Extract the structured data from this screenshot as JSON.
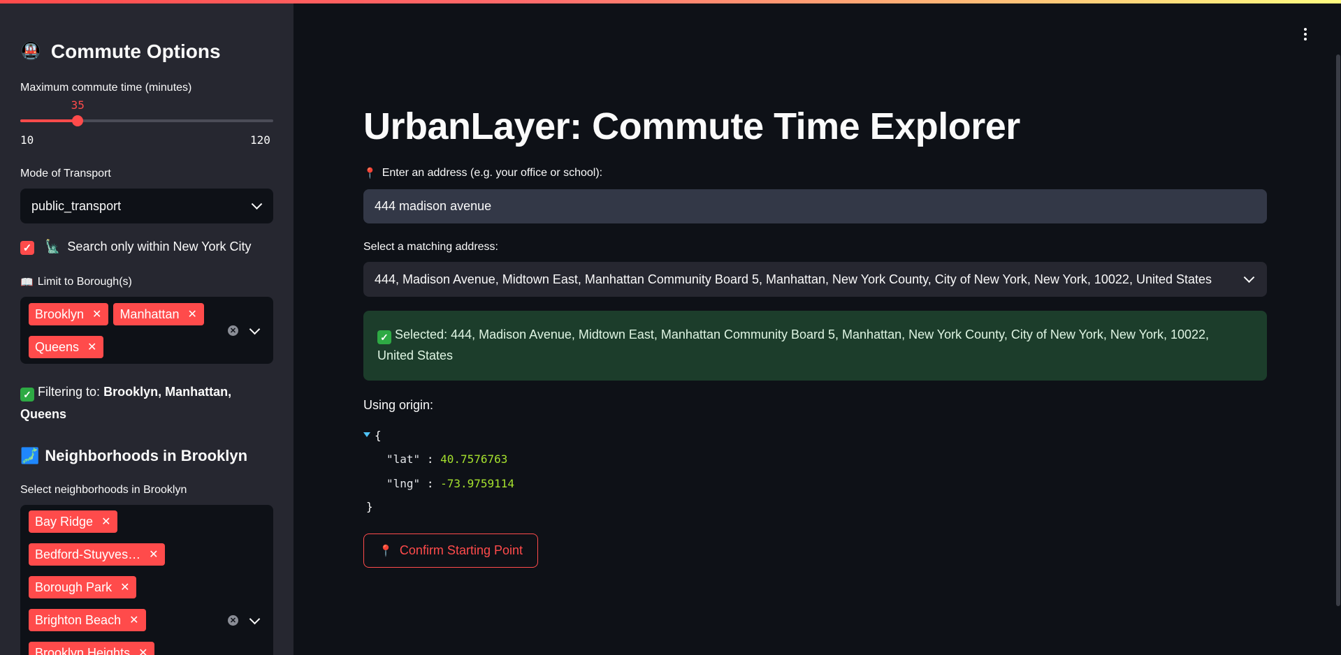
{
  "sidebar": {
    "title": "Commute Options",
    "title_icon": "🚇",
    "slider": {
      "label": "Maximum commute time (minutes)",
      "value": 35,
      "value_text": "35",
      "min": 10,
      "max": 120,
      "min_text": "10",
      "max_text": "120"
    },
    "transport": {
      "label": "Mode of Transport",
      "selected": "public_transport"
    },
    "nyc_checkbox": {
      "checked": true,
      "icon": "🗽",
      "label": "Search only within New York City"
    },
    "borough": {
      "icon": "📖",
      "label": "Limit to Borough(s)",
      "tags": [
        "Brooklyn",
        "Manhattan",
        "Queens"
      ]
    },
    "filter_info": {
      "prefix": "Filtering to:",
      "value": "Brooklyn, Manhattan,",
      "value2": "Queens"
    },
    "neighborhoods_header": {
      "icon": "🗾",
      "title": "Neighborhoods in Brooklyn"
    },
    "neighborhoods": {
      "label": "Select neighborhoods in Brooklyn",
      "tags": [
        "Bay Ridge",
        "Bedford-Stuyves…",
        "Borough Park",
        "Brighton Beach",
        "Brooklyn Heights"
      ]
    }
  },
  "main": {
    "title": "UrbanLayer: Commute Time Explorer",
    "address": {
      "icon": "📍",
      "label": "Enter an address (e.g. your office or school):",
      "value": "444 madison avenue"
    },
    "match": {
      "label": "Select a matching address:",
      "selected": "444, Madison Avenue, Midtown East, Manhattan Community Board 5, Manhattan, New York County, City of New York, New York, 10022, United States"
    },
    "success": {
      "text": "Selected: 444, Madison Avenue, Midtown East, Manhattan Community Board 5, Manhattan, New York County, City of New York, New York, 10022,",
      "text2": "United States"
    },
    "origin_label": "Using origin:",
    "origin": {
      "lat_key": "\"lat\"",
      "lat": "40.7576763",
      "lng_key": "\"lng\"",
      "lng": "-73.9759114"
    },
    "confirm_button": {
      "icon": "📍",
      "label": "Confirm Starting Point"
    }
  },
  "colors": {
    "accent": "#ff4b4b",
    "background": "#0e1117",
    "sidebar": "#262730",
    "success_bg": "#1c3d2b",
    "json_number": "#a6e22e"
  }
}
